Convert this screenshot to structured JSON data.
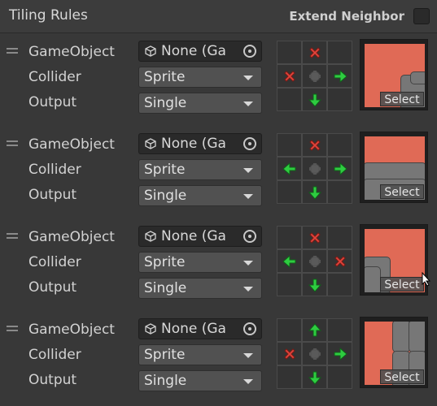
{
  "header": {
    "title": "Tiling Rules",
    "extend_neighbor_label": "Extend Neighbor"
  },
  "labels": {
    "gameobject": "GameObject",
    "collider": "Collider",
    "output": "Output",
    "select": "Select"
  },
  "rules": [
    {
      "gameobject_value": "None (Ga",
      "collider": "Sprite",
      "output": "Single",
      "neighbors": [
        "",
        "x",
        "",
        "x",
        "c",
        "right",
        "",
        "down",
        ""
      ]
    },
    {
      "gameobject_value": "None (Ga",
      "collider": "Sprite",
      "output": "Single",
      "neighbors": [
        "",
        "x",
        "",
        "left",
        "c",
        "right",
        "",
        "down",
        ""
      ]
    },
    {
      "gameobject_value": "None (Ga",
      "collider": "Sprite",
      "output": "Single",
      "neighbors": [
        "",
        "x",
        "",
        "left",
        "c",
        "x",
        "",
        "down",
        ""
      ]
    },
    {
      "gameobject_value": "None (Ga",
      "collider": "Sprite",
      "output": "Single",
      "neighbors": [
        "",
        "up",
        "",
        "x",
        "c",
        "right",
        "",
        "down",
        ""
      ]
    }
  ],
  "colors": {
    "tile_fill": "#e06a56",
    "arrow_green": "#2ecc40",
    "x_red": "#e0453c"
  }
}
